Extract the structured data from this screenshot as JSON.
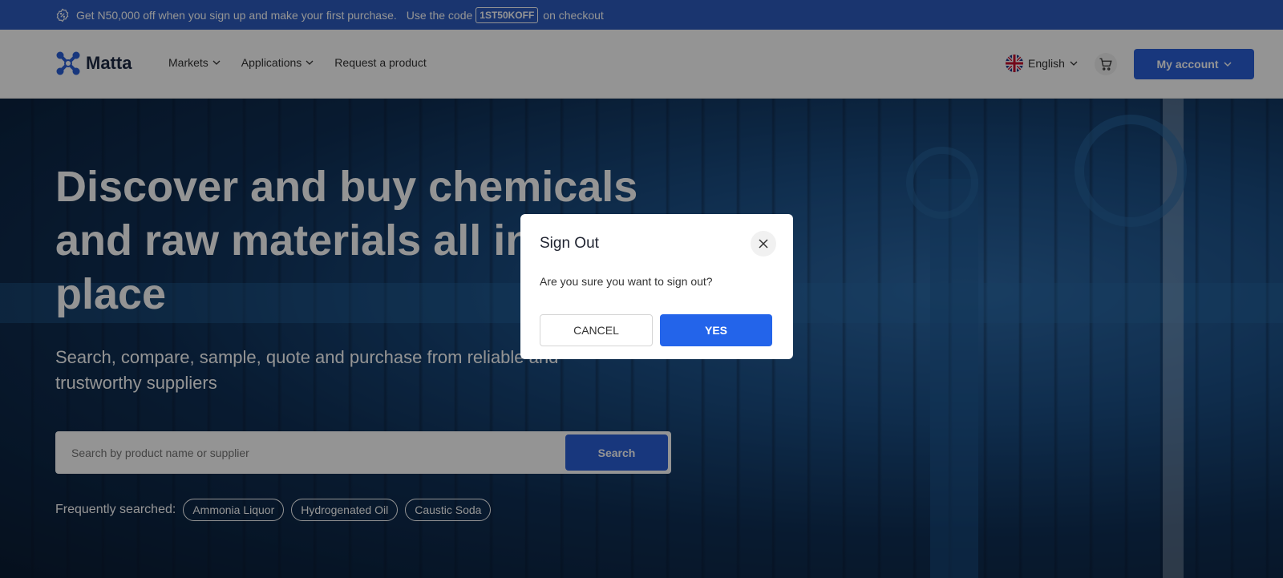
{
  "promo": {
    "text_before": "Get N50,000 off when you sign up and make your first purchase.",
    "code_prefix": "Use the code",
    "code": "1ST50KOFF",
    "code_suffix": "on checkout"
  },
  "header": {
    "logo_text": "Matta",
    "nav": [
      {
        "label": "Markets"
      },
      {
        "label": "Applications"
      },
      {
        "label": "Request a product"
      }
    ],
    "language": "English",
    "account_label": "My account"
  },
  "hero": {
    "headline_line1": "Discover and buy chemicals",
    "headline_line2": "and raw materials all in one",
    "headline_line3": "place",
    "subhead_line1": "Search, compare, sample, quote and purchase from reliable and",
    "subhead_line2": "trustworthy suppliers",
    "search_placeholder": "Search by product name or supplier",
    "search_button": "Search",
    "frequent_label": "Frequently searched:",
    "frequent": [
      "Ammonia Liquor",
      "Hydrogenated Oil",
      "Caustic Soda"
    ]
  },
  "modal": {
    "title": "Sign Out",
    "message": "Are you sure you want to sign out?",
    "cancel_label": "CANCEL",
    "confirm_label": "YES"
  },
  "colors": {
    "brand_blue": "#2a5fd8",
    "promo_bg": "#2d5cbf",
    "yes_button": "#2364ea"
  }
}
